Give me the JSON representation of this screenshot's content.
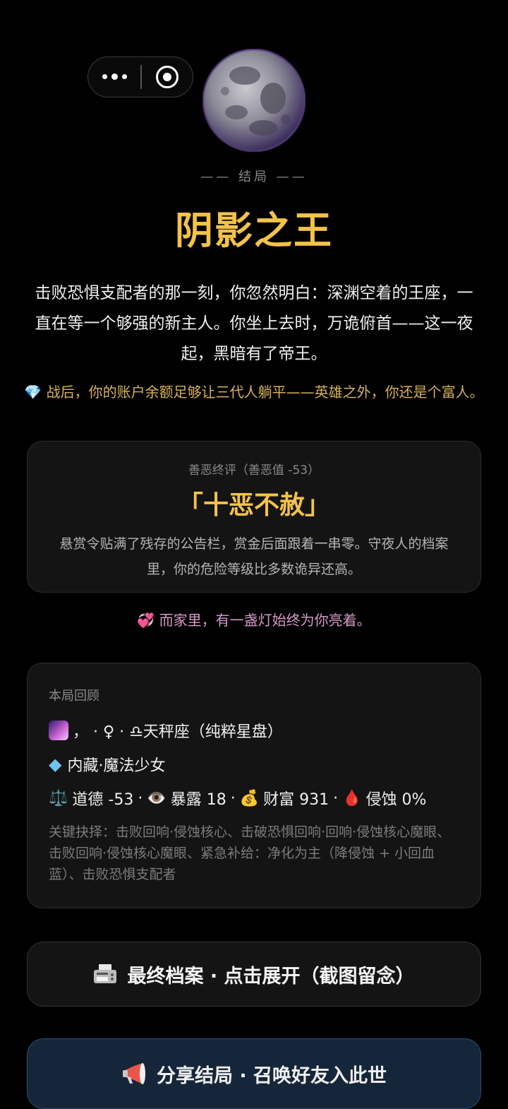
{
  "capsule": {
    "more_icon": "more-dots-icon",
    "close_icon": "close-circle-icon"
  },
  "ending": {
    "label": "—— 结局 ——",
    "title": "阴影之王",
    "story": "击败恐惧支配者的那一刻，你忽然明白：深渊空着的王座，一直在等一个够强的新主人。你坐上去时，万诡俯首——这一夜起，黑暗有了帝王。",
    "wealth_note": "💎 战后，你的账户余额足够让三代人躺平——英雄之外，你还是个富人。"
  },
  "karma": {
    "label": "善恶终评（善恶值 -53）",
    "title": "「十恶不赦」",
    "description": "悬赏令贴满了残存的公告栏，赏金后面跟着一串零。守夜人的档案里，你的危险等级比多数诡异还高。"
  },
  "home_note": "💞 而家里，有一盏灯始终为你亮着。",
  "recap": {
    "title": "本局回顾",
    "line1": "， · ♀ · ♎天秤座（纯粹星盘）",
    "line2": "内藏·魔法少女",
    "stats": [
      {
        "icon": "⚖️",
        "text": "道德 -53"
      },
      {
        "icon": "👁️",
        "text": "暴露 18"
      },
      {
        "icon": "💰",
        "text": "财富 931"
      },
      {
        "icon": "🩸",
        "text": "侵蚀 0%"
      }
    ],
    "choices": "关键抉择：击败回响·侵蚀核心、击破恐惧回响·回响·侵蚀核心魔眼、击败回响·侵蚀核心魔眼、紧急补给：净化为主（降侵蚀 + 小回血蓝）、击败恐惧支配者"
  },
  "buttons": {
    "archive": "最终档案 · 点击展开（截图留念）",
    "share": "分享结局 · 召唤好友入此世"
  },
  "colors": {
    "gold": "#f2c24a",
    "pink": "#d79ac8",
    "share_bg": "#15263a"
  }
}
